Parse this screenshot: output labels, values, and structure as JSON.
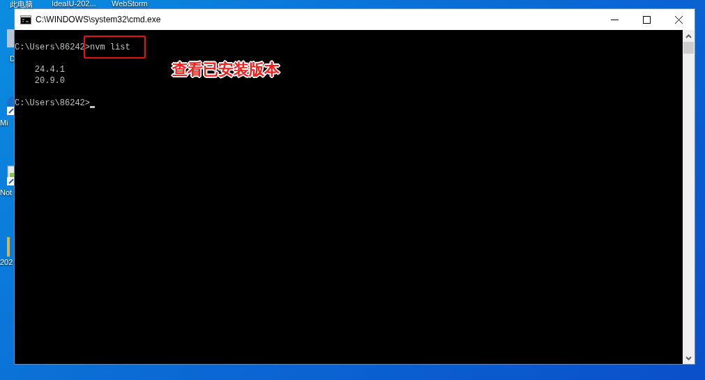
{
  "desktop": {
    "top_icons": [
      {
        "label": "此电脑"
      },
      {
        "label": "IdeaIU-202..."
      },
      {
        "label": "WebStorm"
      }
    ],
    "left_icons": [
      {
        "label": "D"
      },
      {
        "label": "Mi"
      },
      {
        "label": "Not"
      },
      {
        "label": "202"
      }
    ]
  },
  "window": {
    "title": "C:\\WINDOWS\\system32\\cmd.exe",
    "lines": [
      {
        "kind": "prompt",
        "prompt": "C:\\Users\\86242>",
        "command": "nvm list",
        "highlighted": true
      },
      {
        "kind": "blank"
      },
      {
        "kind": "output",
        "text": "24.4.1"
      },
      {
        "kind": "output",
        "text": "20.9.0"
      },
      {
        "kind": "blank"
      },
      {
        "kind": "cursor_prompt",
        "prompt": "C:\\Users\\86242>",
        "cursor": true
      }
    ],
    "annotation": "查看已安装版本"
  }
}
